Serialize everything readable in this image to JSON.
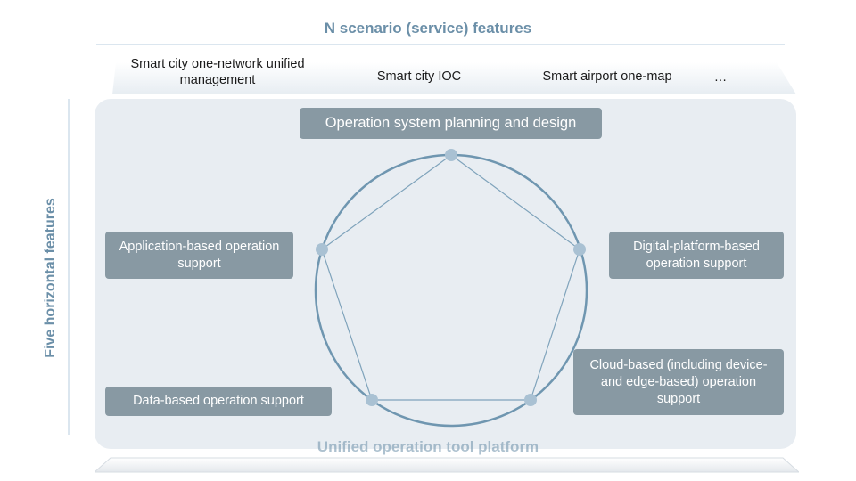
{
  "header": {
    "title": "N scenario (service) features"
  },
  "scenarios": [
    "Smart city one-network unified management",
    "Smart city IOC",
    "Smart airport one-map",
    "…"
  ],
  "side_label": "Five horizontal features",
  "features": {
    "top": "Operation system planning and design",
    "left": "Application-based operation support",
    "right": "Digital-platform-based operation support",
    "bottom_left": "Data-based operation support",
    "bottom_right": "Cloud-based (including device- and edge-based) operation support"
  },
  "footer": {
    "platform_label": "Unified operation tool platform"
  },
  "colors": {
    "accent_text": "#6b8fa8",
    "box_fill": "#8899a3",
    "panel_fill": "#e8edf2",
    "circle_stroke": "#6f96b0",
    "node_fill": "#a9c1d3"
  }
}
